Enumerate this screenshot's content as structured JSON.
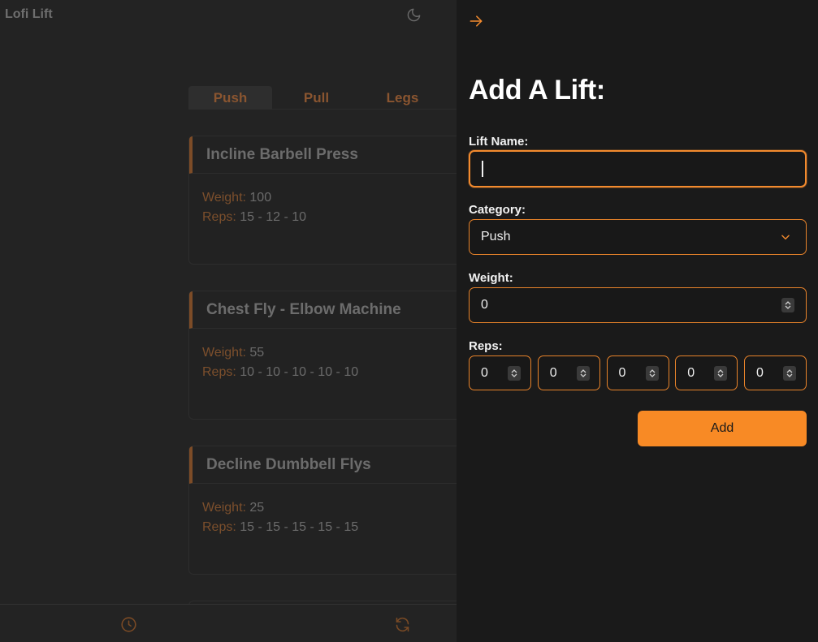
{
  "app": {
    "title": "Lofi Lift",
    "tabs": [
      {
        "label": "Push",
        "active": true
      },
      {
        "label": "Pull",
        "active": false
      },
      {
        "label": "Legs",
        "active": false
      }
    ],
    "weight_label": "Weight:",
    "reps_label": "Reps:",
    "cards": [
      {
        "title": "Incline Barbell Press",
        "weight": "100",
        "reps": "15 - 12 - 10"
      },
      {
        "title": "Chest Fly - Elbow Machine",
        "weight": "55",
        "reps": "10 - 10 - 10 - 10 - 10"
      },
      {
        "title": "Decline Dumbbell Flys",
        "weight": "25",
        "reps": "15 - 15 - 15 - 15 - 15"
      }
    ]
  },
  "drawer": {
    "title": "Add A Lift:",
    "lift_name_label": "Lift Name:",
    "lift_name_value": "",
    "category_label": "Category:",
    "category_value": "Push",
    "weight_label": "Weight:",
    "weight_value": "0",
    "reps_label": "Reps:",
    "reps_values": [
      "0",
      "0",
      "0",
      "0",
      "0"
    ],
    "add_button": "Add"
  },
  "colors": {
    "accent": "#f88a25",
    "drawer_bg": "#1a1a1a",
    "dimmed_accent": "#8a5530"
  },
  "icons": [
    "moon-icon",
    "arrow-right-icon",
    "chevron-down-icon",
    "clock-icon",
    "refresh-icon"
  ]
}
